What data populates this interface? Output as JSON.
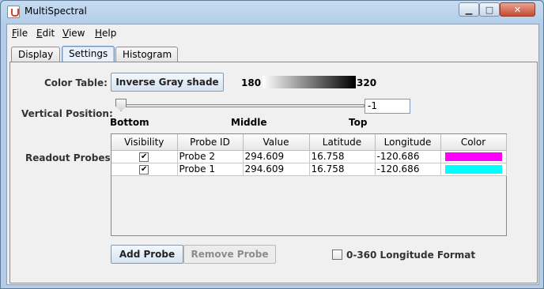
{
  "window": {
    "title": "MultiSpectral"
  },
  "menu": {
    "items": [
      "File",
      "Edit",
      "View",
      "Help"
    ]
  },
  "tabs": [
    {
      "label": "Display"
    },
    {
      "label": "Settings",
      "active": true
    },
    {
      "label": "Histogram"
    }
  ],
  "settings": {
    "color_table_label": "Color Table:",
    "color_table_button": "Inverse Gray shade",
    "range_min": "180",
    "range_max": "320",
    "vertical_position_label": "Vertical Position:",
    "vertical_position_value": "-1",
    "slider_labels": [
      "Bottom",
      "Middle",
      "Top"
    ],
    "readout_probes_label": "Readout Probes:"
  },
  "probes_table": {
    "columns": [
      "Visibility",
      "Probe ID",
      "Value",
      "Latitude",
      "Longitude",
      "Color"
    ],
    "rows": [
      {
        "visible": true,
        "probe_id": "Probe 2",
        "value": "294.609",
        "latitude": "16.758",
        "longitude": "-120.686",
        "color": "#ff00ff"
      },
      {
        "visible": true,
        "probe_id": "Probe 1",
        "value": "294.609",
        "latitude": "16.758",
        "longitude": "-120.686",
        "color": "#00ffff"
      }
    ]
  },
  "buttons": {
    "add_probe": "Add Probe",
    "remove_probe": "Remove Probe",
    "longitude_format": "0-360 Longitude Format"
  }
}
